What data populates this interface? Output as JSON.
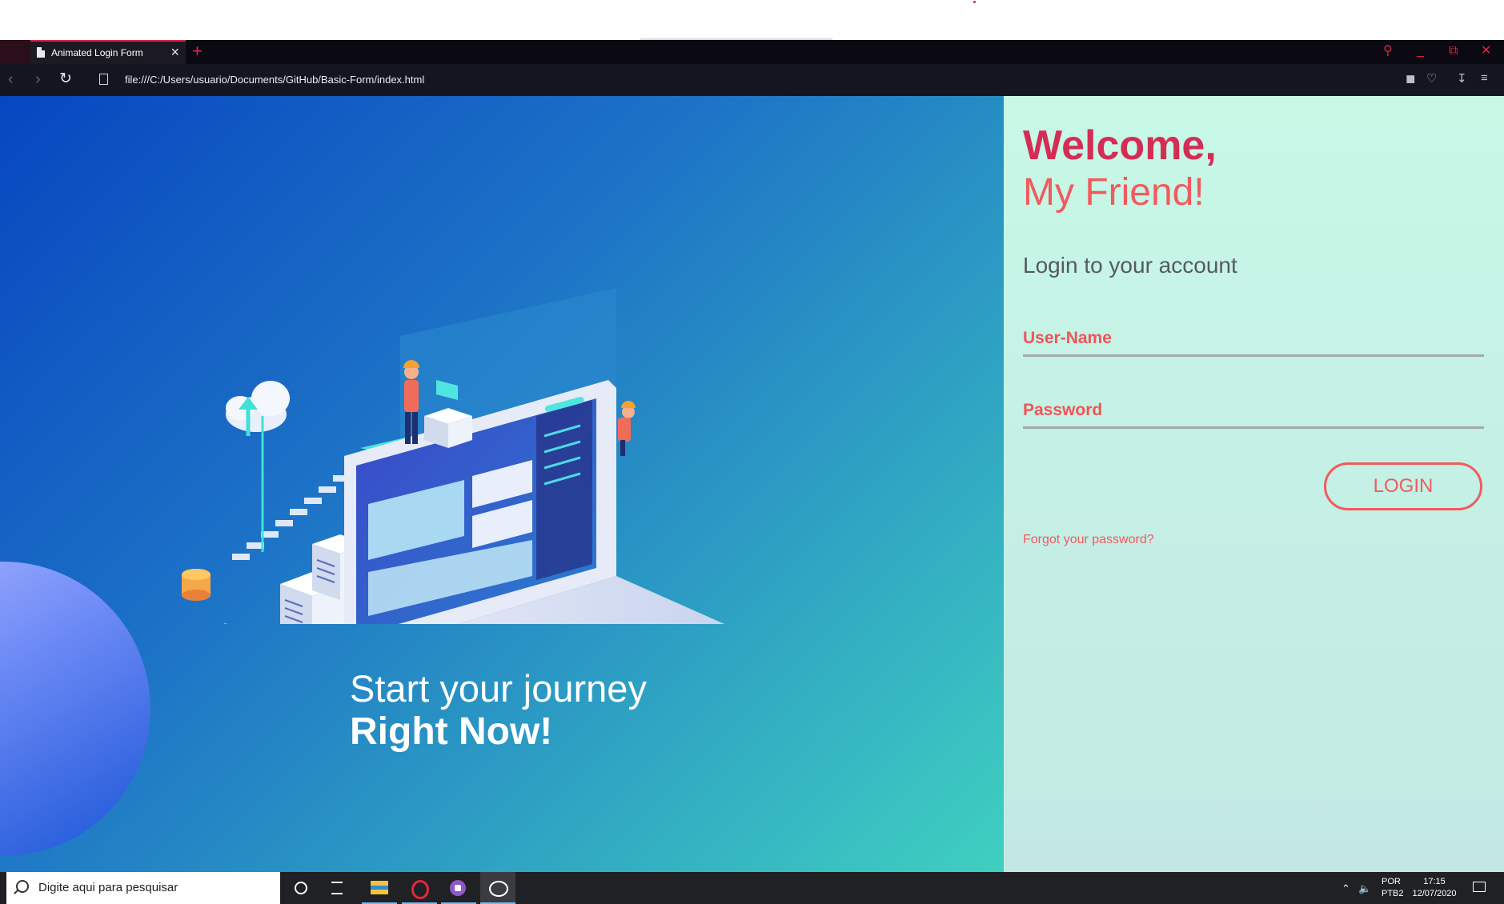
{
  "browser": {
    "tab_title": "Animated Login Form",
    "url": "file:///C:/Users/usuario/Documents/GitHub/Basic-Form/index.html",
    "accent": "#d6254a"
  },
  "page": {
    "tagline_line1": "Start your journey",
    "tagline_line2": "Right Now!",
    "welcome": "Welcome,",
    "friend": "My Friend!",
    "subtitle": "Login to your account",
    "username_label": "User-Name",
    "password_label": "Password",
    "login_button": "LOGIN",
    "forgot_link": "Forgot your password?",
    "colors": {
      "brand": "#d42d55",
      "accent": "#f25a5e",
      "left_gradient_start": "#0746c0",
      "left_gradient_end": "#3fd0c0",
      "right_background": "#c7f8e6"
    }
  },
  "taskbar": {
    "search_placeholder": "Digite aqui para pesquisar",
    "lang_top": "POR",
    "lang_bottom": "PTB2",
    "time": "17:15",
    "date": "12/07/2020",
    "icons": [
      "cortana-icon",
      "task-view-icon",
      "file-explorer-icon",
      "opera-icon",
      "purple-app-icon",
      "photos-icon"
    ]
  }
}
